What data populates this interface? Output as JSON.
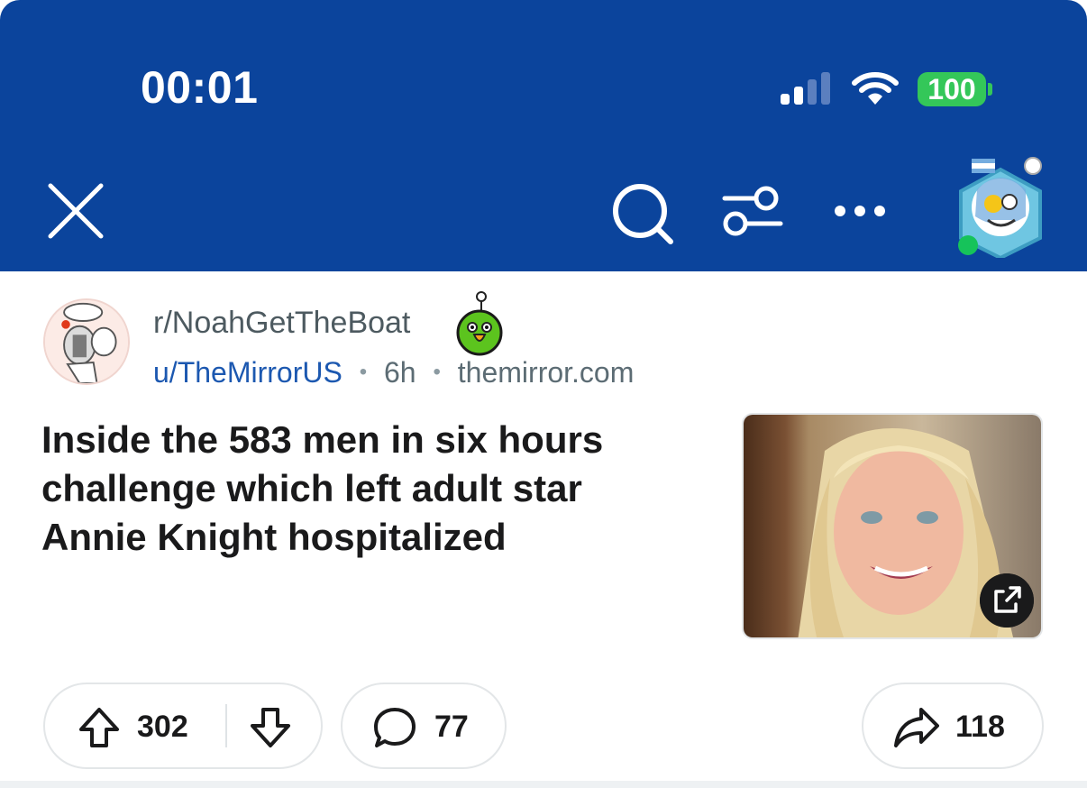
{
  "status_bar": {
    "time": "00:01",
    "battery": "100"
  },
  "toolbar": {
    "close_icon": "close-icon",
    "search_icon": "search-icon",
    "filter_icon": "filter-icon",
    "more_icon": "more-horizontal-icon"
  },
  "post": {
    "subreddit": "r/NoahGetTheBoat",
    "author": "u/TheMirrorUS",
    "age": "6h",
    "domain": "themirror.com",
    "title": "Inside the 583 men in six hours challenge which left adult star Annie Knight hospitalized",
    "upvotes": "302",
    "comments": "77",
    "shares": "118"
  },
  "colors": {
    "header_bg": "#0b449c",
    "battery": "#34c759",
    "online_dot": "#16c35a",
    "author_link": "#1c58b0"
  }
}
